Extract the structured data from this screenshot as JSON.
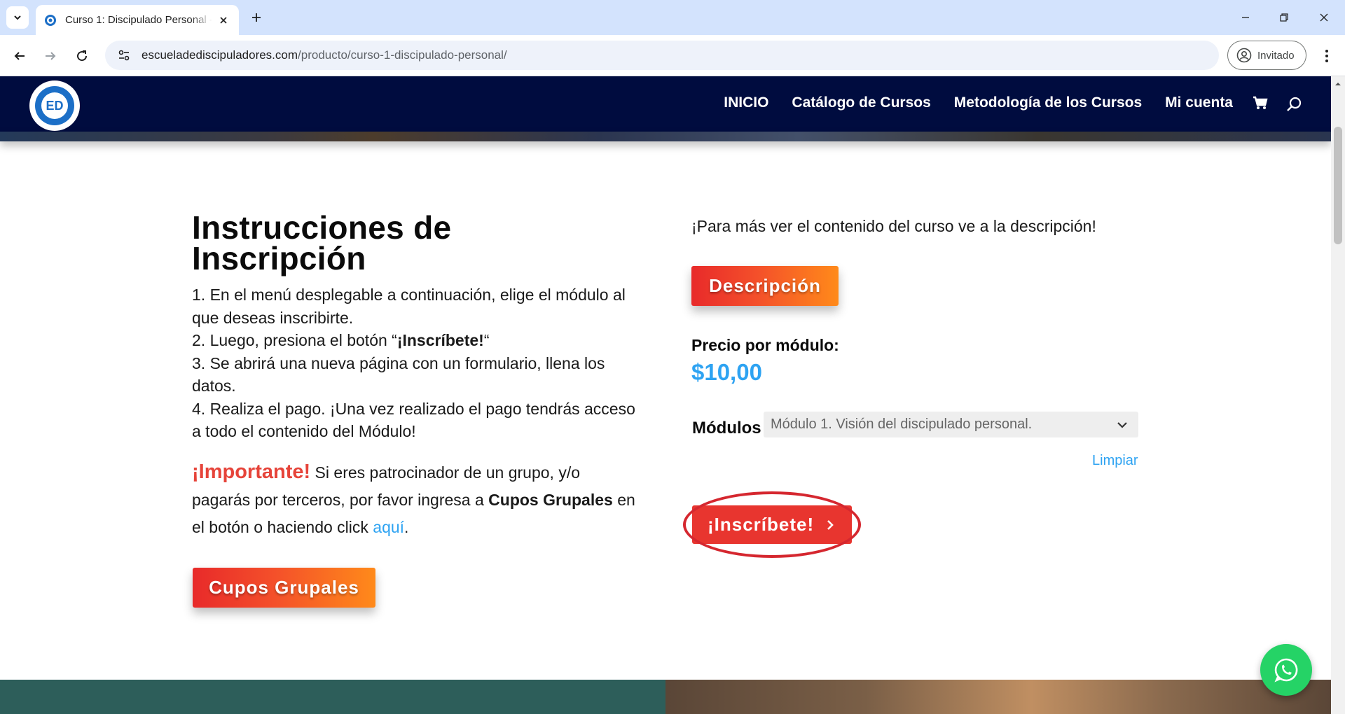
{
  "browser": {
    "tab_title": "Curso 1: Discipulado Personal -",
    "url_host": "escueladediscipuladores.com",
    "url_path": "/producto/curso-1-discipulado-personal/",
    "profile_label": "Invitado"
  },
  "site": {
    "logo_text": "ED",
    "nav": [
      {
        "label": "INICIO"
      },
      {
        "label": "Catálogo de Cursos"
      },
      {
        "label": "Metodología de los Cursos"
      },
      {
        "label": "Mi cuenta"
      }
    ]
  },
  "instructions": {
    "heading_line1": "Instrucciones de",
    "heading_line2": "Inscripción",
    "step1": "1. En el menú desplegable a continuación, elige el módulo al que deseas inscribirte.",
    "step2_prefix": "2. Luego, presiona el botón “",
    "step2_bold": "¡Inscríbete!",
    "step2_suffix": "“",
    "step3": "3. Se abrirá una nueva página con un formulario, llena los datos.",
    "step4": "4. Realiza el pago. ¡Una vez realizado el pago tendrás acceso a todo el contenido del Módulo!",
    "important_label": "¡Importante!",
    "important_text1": " Si eres patrocinador de un grupo, y/o pagarás por terceros, por favor ingresa a ",
    "important_bold": "Cupos Grupales",
    "important_text2": " en el botón o haciendo click ",
    "important_link": "aquí",
    "important_end": ".",
    "cupos_button": "Cupos Grupales"
  },
  "product": {
    "info_text": "¡Para más ver el contenido del curso ve a la descripción!",
    "description_button": "Descripción",
    "price_label": "Precio por módulo:",
    "price_value": "$10,00",
    "modules_label": "Módulos",
    "modules_selected": "Módulo 1. Visión del discipulado personal.",
    "clear_link": "Limpiar",
    "enroll_button": "¡Inscríbete!"
  },
  "colors": {
    "header_bg": "#000c3f",
    "accent_blue": "#2ea3f2",
    "enroll_red": "#e8352f",
    "highlight_red": "#d5272f",
    "whatsapp_green": "#25d366"
  }
}
